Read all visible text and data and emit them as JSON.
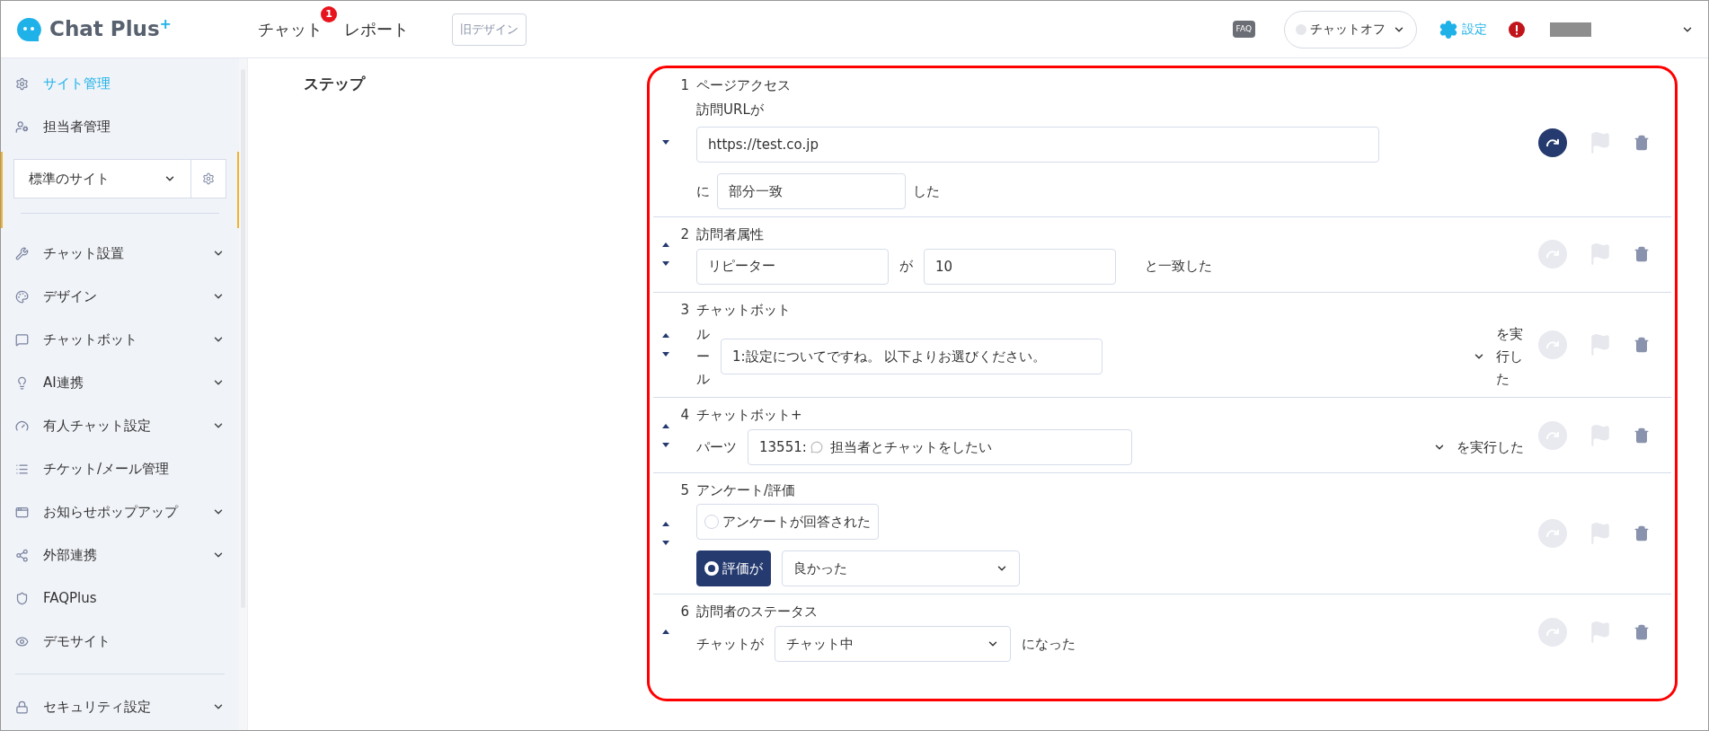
{
  "header": {
    "logo": {
      "name": "Chat Plus",
      "sup": "+"
    },
    "nav": [
      {
        "label": "チャット",
        "badge": "1"
      },
      {
        "label": "レポート"
      }
    ],
    "old_design_button": "旧デザイン",
    "faq": "FAQ",
    "chat_status": {
      "label": "チャットオフ",
      "on": false
    },
    "settings": "設定"
  },
  "sidebar": {
    "top_items": [
      {
        "label": "サイト管理",
        "kind": "gear",
        "selected": true
      },
      {
        "label": "担当者管理",
        "kind": "user-gear",
        "selected": false
      }
    ],
    "site_select": "標準のサイト",
    "items": [
      {
        "label": "チャット設置",
        "kind": "wrench",
        "expandable": true
      },
      {
        "label": "デザイン",
        "kind": "palette",
        "expandable": true
      },
      {
        "label": "チャットボット",
        "kind": "chat",
        "expandable": true
      },
      {
        "label": "AI連携",
        "kind": "bulb",
        "expandable": true
      },
      {
        "label": "有人チャット設定",
        "kind": "gauge",
        "expandable": true
      },
      {
        "label": "チケット/メール管理",
        "kind": "list",
        "expandable": false
      },
      {
        "label": "お知らせポップアップ",
        "kind": "window",
        "expandable": true
      },
      {
        "label": "外部連携",
        "kind": "share",
        "expandable": true
      },
      {
        "label": "FAQPlus",
        "kind": "shield",
        "expandable": false
      },
      {
        "label": "デモサイト",
        "kind": "eye",
        "expandable": false
      }
    ],
    "bottom_items": [
      {
        "label": "セキュリティ設定",
        "kind": "lock",
        "expandable": true
      }
    ]
  },
  "section_label": "ステップ",
  "steps": [
    {
      "number": "1",
      "title": "ページアクセス",
      "kind": "page-access",
      "can_move_up": false,
      "can_move_down": true,
      "skip_active": true,
      "label": "訪問URLが",
      "url": "https://test.co.jp",
      "prefix": "に",
      "match": "部分一致",
      "suffix": "した"
    },
    {
      "number": "2",
      "title": "訪問者属性",
      "kind": "attribute",
      "can_move_up": true,
      "can_move_down": true,
      "skip_active": false,
      "attribute": "リピーター",
      "conjunction": "が",
      "value": "10",
      "suffix": "と一致した"
    },
    {
      "number": "3",
      "title": "チャットボット",
      "kind": "chatbot",
      "can_move_up": true,
      "can_move_down": true,
      "skip_active": false,
      "label": "ルール",
      "rule": "1:設定についてですね。 以下よりお選びください。",
      "suffix": "を実行した"
    },
    {
      "number": "4",
      "title": "チャットボット+",
      "kind": "chatbot-plus",
      "can_move_up": true,
      "can_move_down": true,
      "skip_active": false,
      "label": "パーツ",
      "part_id": "13551:",
      "part_name": "担当者とチャットをしたい",
      "suffix": "を実行した"
    },
    {
      "number": "5",
      "title": "アンケート/評価",
      "kind": "survey",
      "can_move_up": true,
      "can_move_down": true,
      "skip_active": false,
      "options": [
        {
          "label": "アンケートが回答された",
          "selected": false
        },
        {
          "label": "評価が",
          "selected": true
        }
      ],
      "rating": "良かった"
    },
    {
      "number": "6",
      "title": "訪問者のステータス",
      "kind": "status",
      "can_move_up": true,
      "can_move_down": false,
      "skip_active": false,
      "label": "チャットが",
      "status": "チャット中",
      "suffix": "になった"
    }
  ]
}
